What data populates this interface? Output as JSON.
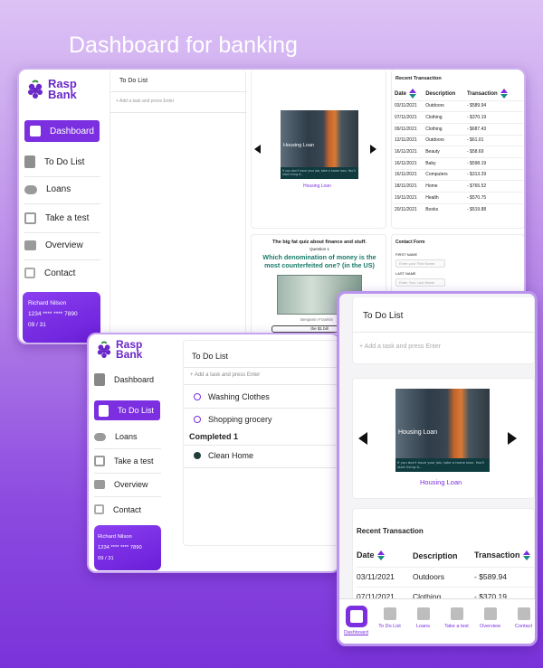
{
  "hero_title": "Dashboard for banking",
  "brand": {
    "line1": "Rasp",
    "line2": "Bank"
  },
  "nav": [
    {
      "label": "Dashboard",
      "icon": "dashboard-icon"
    },
    {
      "label": "To Do List",
      "icon": "clipboard-icon"
    },
    {
      "label": "Loans",
      "icon": "piggy-bank-icon"
    },
    {
      "label": "Take a test",
      "icon": "test-icon"
    },
    {
      "label": "Overview",
      "icon": "wallet-icon"
    },
    {
      "label": "Contact",
      "icon": "edit-icon"
    }
  ],
  "card": {
    "name": "Richard Nilson",
    "number": "1234 **** **** 7890",
    "expiry": "09 / 31"
  },
  "todo": {
    "title": "To Do List",
    "placeholder": "+ Add a task and press Enter",
    "pending": [
      "Washing Clothes",
      "Shopping grocery"
    ],
    "completed_label": "Completed 1",
    "completed": [
      "Clean Home"
    ]
  },
  "carousel": {
    "slide_title": "Housing Loan",
    "slide_caption": "If you don't have your job, take a home loan. You'll start living it...",
    "link": "Housing Loan"
  },
  "quiz": {
    "title": "The big fat quiz about finance and stuff.",
    "question_no": "Question 1",
    "question": "Which denomination of money is the most counterfeited one? (in the US)",
    "image_caption": "Benjamin Franklin",
    "answer": "the $1 bill"
  },
  "transactions": {
    "title": "Recent Transaction",
    "headers": [
      "Date",
      "Description",
      "Transaction"
    ],
    "rows": [
      [
        "03/11/2021",
        "Outdoors",
        "- $589.94"
      ],
      [
        "07/11/2021",
        "Clothing",
        "- $370.19"
      ],
      [
        "09/11/2021",
        "Clothing",
        "- $687.43"
      ],
      [
        "12/11/2021",
        "Outdoors",
        "- $61.01"
      ],
      [
        "16/11/2021",
        "Beauty",
        "- $58.69"
      ],
      [
        "16/11/2021",
        "Baby",
        "- $598.19"
      ],
      [
        "16/11/2021",
        "Computers",
        "- $313.29"
      ],
      [
        "18/11/2021",
        "Home",
        "- $765.52"
      ],
      [
        "19/11/2021",
        "Health",
        "- $570.75"
      ],
      [
        "20/11/2021",
        "Books",
        "- $519.88"
      ]
    ]
  },
  "contact": {
    "title": "Contact Form",
    "first_label": "FIRST NAME",
    "first_placeholder": "Enter your First Name",
    "last_label": "LAST NAME",
    "last_placeholder": "Enter Your Last Name"
  },
  "mobile_nav": [
    {
      "label": "Dashboard",
      "icon": "dashboard-icon"
    },
    {
      "label": "To Do List",
      "icon": "clipboard-icon"
    },
    {
      "label": "Loans",
      "icon": "piggy-bank-icon"
    },
    {
      "label": "Take a test",
      "icon": "test-icon"
    },
    {
      "label": "Overview",
      "icon": "wallet-icon"
    },
    {
      "label": "Contact",
      "icon": "edit-icon"
    }
  ],
  "colors": {
    "accent": "#7b2fe0",
    "teal": "#1a8a7d"
  }
}
